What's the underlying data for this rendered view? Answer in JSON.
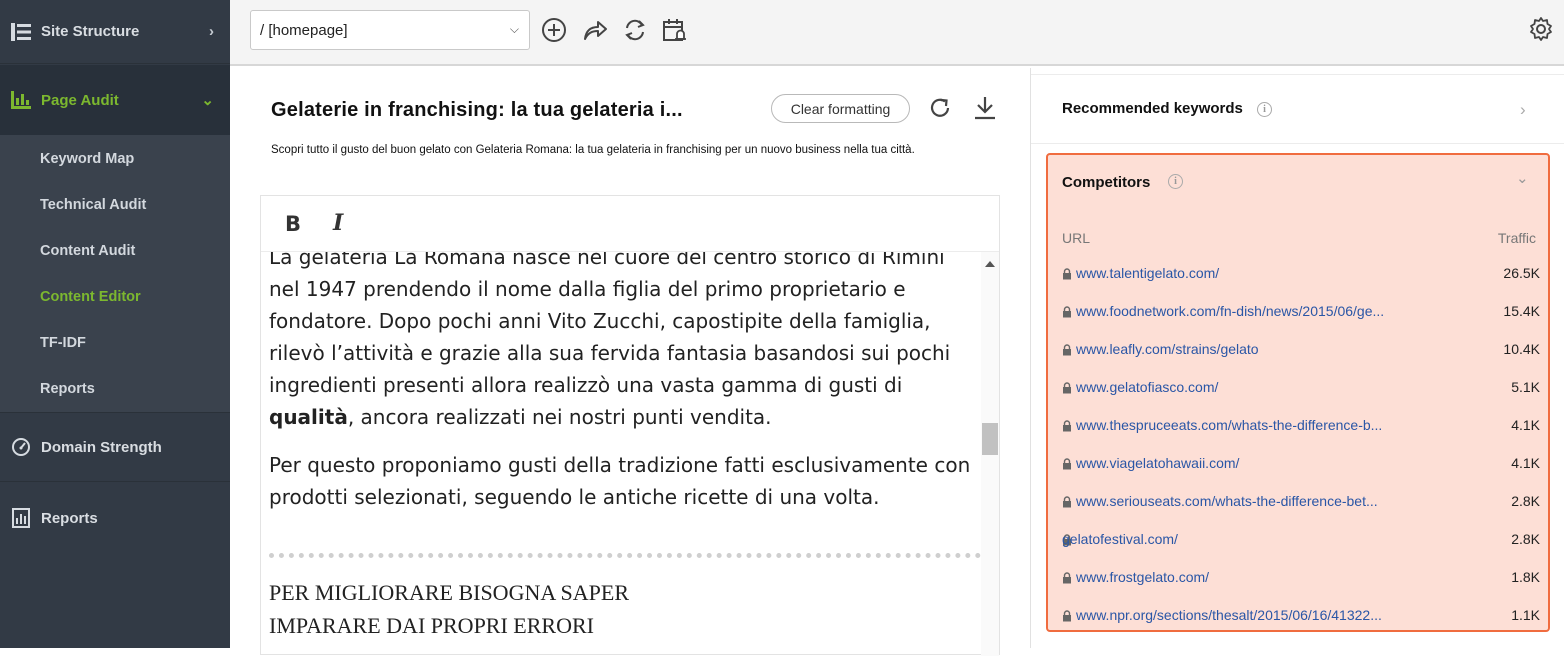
{
  "sidebar": {
    "site_structure": "Site Structure",
    "page_audit": "Page Audit",
    "sub_items": [
      "Keyword Map",
      "Technical Audit",
      "Content Audit",
      "Content Editor",
      "TF-IDF",
      "Reports"
    ],
    "domain_strength": "Domain Strength",
    "reports": "Reports",
    "accent_color": "#7cb82f"
  },
  "toolbar": {
    "url_value": "/ [homepage]",
    "icons": [
      "add-circle-icon",
      "share-icon",
      "refresh-icon",
      "schedule-alert-icon",
      "settings-icon"
    ]
  },
  "editor": {
    "title": "Gelaterie in franchising: la tua gelateria i...",
    "clear_formatting": "Clear formatting",
    "description": "Scopri tutto il gusto del buon gelato con Gelateria Romana: la tua gelateria in franchising per un nuovo business nella tua città.",
    "bold_label": "B",
    "italic_label": "I",
    "para1_before": "La gelateria La Romana nasce nel cuore del centro storico di Rimini nel 1947 prendendo il nome dalla figlia del primo proprietario e fondatore. Dopo pochi anni Vito Zucchi, capostipite della famiglia, rilevò l’attività e grazie alla sua fervida fantasia basandosi sui pochi ingredienti presenti allora realizzò una vasta gamma di gusti di ",
    "para1_bold": "qualità",
    "para1_after": ", ancora realizzati nei nostri punti vendita.",
    "para2": "Per questo proponiamo gusti della tradizione fatti esclusivamente con prodotti selezionati, seguendo le antiche ricette di una volta.",
    "heading_line1": "PER MIGLIORARE BISOGNA SAPER",
    "heading_line2": "IMPARARE DAI PROPRI ERRORI"
  },
  "right_panel": {
    "recommended_keywords": "Recommended keywords",
    "competitors": {
      "title": "Competitors",
      "col_url": "URL",
      "col_traffic": "Traffic",
      "rows": [
        {
          "url": "www.talentigelato.com/",
          "traffic": "26.5K"
        },
        {
          "url": "www.foodnetwork.com/fn-dish/news/2015/06/ge...",
          "traffic": "15.4K"
        },
        {
          "url": "www.leafly.com/strains/gelato",
          "traffic": "10.4K"
        },
        {
          "url": "www.gelatofiasco.com/",
          "traffic": "5.1K"
        },
        {
          "url": "www.thespruceeats.com/whats-the-difference-b...",
          "traffic": "4.1K"
        },
        {
          "url": "www.viagelatohawaii.com/",
          "traffic": "4.1K"
        },
        {
          "url": "www.seriouseats.com/whats-the-difference-bet...",
          "traffic": "2.8K"
        },
        {
          "url": "gelatofestival.com/",
          "traffic": "2.8K"
        },
        {
          "url": "www.frostgelato.com/",
          "traffic": "1.8K"
        },
        {
          "url": "www.npr.org/sections/thesalt/2015/06/16/41322...",
          "traffic": "1.1K"
        }
      ]
    }
  }
}
